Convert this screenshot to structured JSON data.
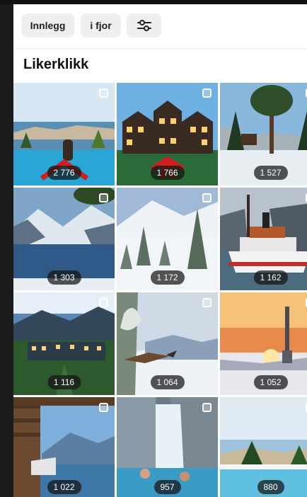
{
  "filters": {
    "chip1_label": "Innlegg",
    "chip2_label": "i fjor",
    "settings_icon": "sliders-icon"
  },
  "section": {
    "title": "Likerklikk"
  },
  "tiles": [
    {
      "likes": "2 776",
      "scene": "coastal-town-pool"
    },
    {
      "likes": "1 766",
      "scene": "hotel-with-red-ribbon"
    },
    {
      "likes": "1 527",
      "scene": "pine-forest-snow"
    },
    {
      "likes": "1 303",
      "scene": "fjord-mountains"
    },
    {
      "likes": "1 172",
      "scene": "snowy-forest"
    },
    {
      "likes": "1 162",
      "scene": "steamship"
    },
    {
      "likes": "1 116",
      "scene": "hotel-at-dusk"
    },
    {
      "likes": "1 064",
      "scene": "bird-in-winter-tree"
    },
    {
      "likes": "1 052",
      "scene": "tower-at-sunset"
    },
    {
      "likes": "1 022",
      "scene": "cabin-fjord-view"
    },
    {
      "likes": "957",
      "scene": "waterfall-pool"
    },
    {
      "likes": "880",
      "scene": "lake-pool"
    }
  ]
}
